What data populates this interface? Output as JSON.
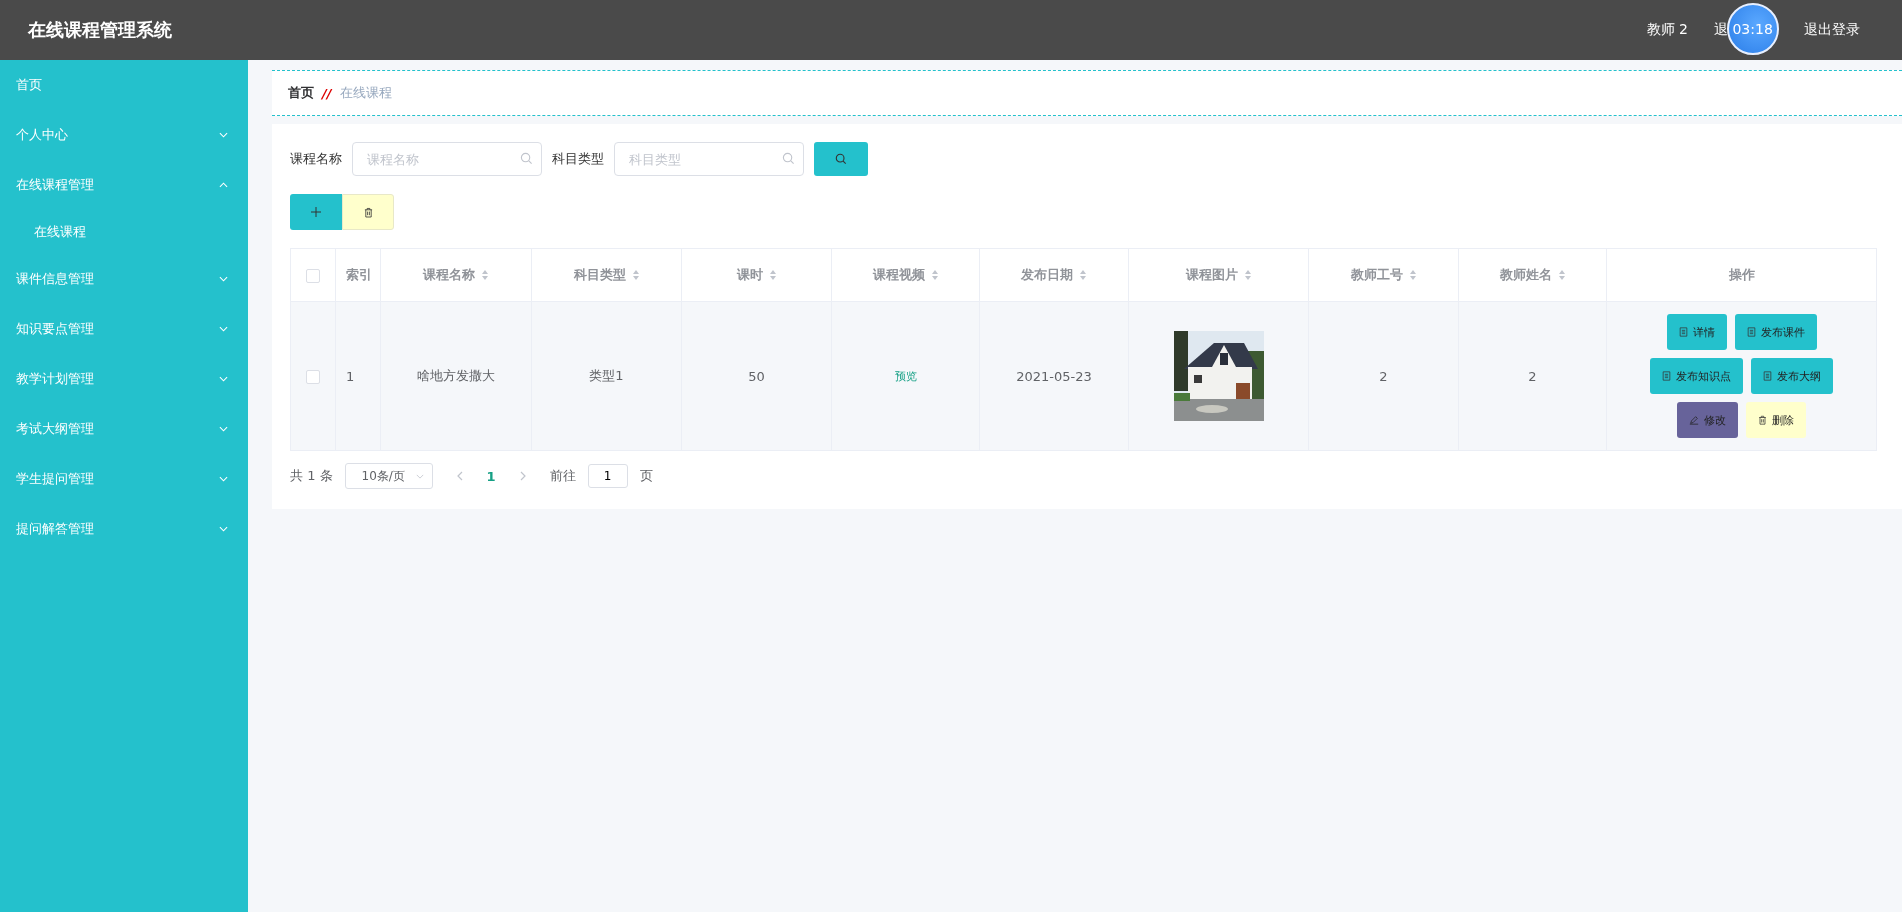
{
  "header": {
    "title": "在线课程管理系统",
    "user": "教师 2",
    "link_partial": "退",
    "logout": "退出登录",
    "timer": "03:18"
  },
  "sidebar": {
    "items": [
      {
        "label": "首页"
      },
      {
        "label": "个人中心",
        "expanded": false
      },
      {
        "label": "在线课程管理",
        "expanded": true,
        "children": [
          {
            "label": "在线课程"
          }
        ]
      },
      {
        "label": "课件信息管理",
        "expanded": false
      },
      {
        "label": "知识要点管理",
        "expanded": false
      },
      {
        "label": "教学计划管理",
        "expanded": false
      },
      {
        "label": "考试大纲管理",
        "expanded": false
      },
      {
        "label": "学生提问管理",
        "expanded": false
      },
      {
        "label": "提问解答管理",
        "expanded": false
      }
    ]
  },
  "breadcrumb": {
    "home": "首页",
    "separator": "//",
    "current": "在线课程"
  },
  "search": {
    "fields": [
      {
        "label": "课程名称",
        "placeholder": "课程名称"
      },
      {
        "label": "科目类型",
        "placeholder": "科目类型"
      }
    ]
  },
  "table": {
    "header_checkbox": {
      "checked": false
    },
    "columns": [
      {
        "label": "索引",
        "sortable": false
      },
      {
        "label": "课程名称",
        "sortable": true
      },
      {
        "label": "科目类型",
        "sortable": true
      },
      {
        "label": "课时",
        "sortable": true
      },
      {
        "label": "课程视频",
        "sortable": true
      },
      {
        "label": "发布日期",
        "sortable": true
      },
      {
        "label": "课程图片",
        "sortable": true
      },
      {
        "label": "教师工号",
        "sortable": true
      },
      {
        "label": "教师姓名",
        "sortable": true
      },
      {
        "label": "操作",
        "sortable": false
      }
    ],
    "rows": [
      {
        "selected": false,
        "index": "1",
        "name": "啥地方发撒大",
        "type": "类型1",
        "hours": "50",
        "video": "预览",
        "date": "2021-05-23",
        "image": {
          "kind": "picture"
        },
        "teacher_id": "2",
        "teacher_name": "2",
        "actions": [
          [
            {
              "label": "详情",
              "kind": "primary"
            },
            {
              "label": "发布课件",
              "kind": "primary"
            }
          ],
          [
            {
              "label": "发布知识点",
              "kind": "primary"
            },
            {
              "label": "发布大纲",
              "kind": "primary"
            }
          ],
          [
            {
              "label": "修改",
              "kind": "edit"
            },
            {
              "label": "删除",
              "kind": "delete"
            }
          ]
        ]
      }
    ]
  },
  "pagination": {
    "total": "共 1 条",
    "page_size": "10条/页",
    "pages": [
      {
        "label": "1",
        "selected": true
      }
    ],
    "goto_label": "前往",
    "goto_value": "1",
    "goto_suffix": "页"
  }
}
